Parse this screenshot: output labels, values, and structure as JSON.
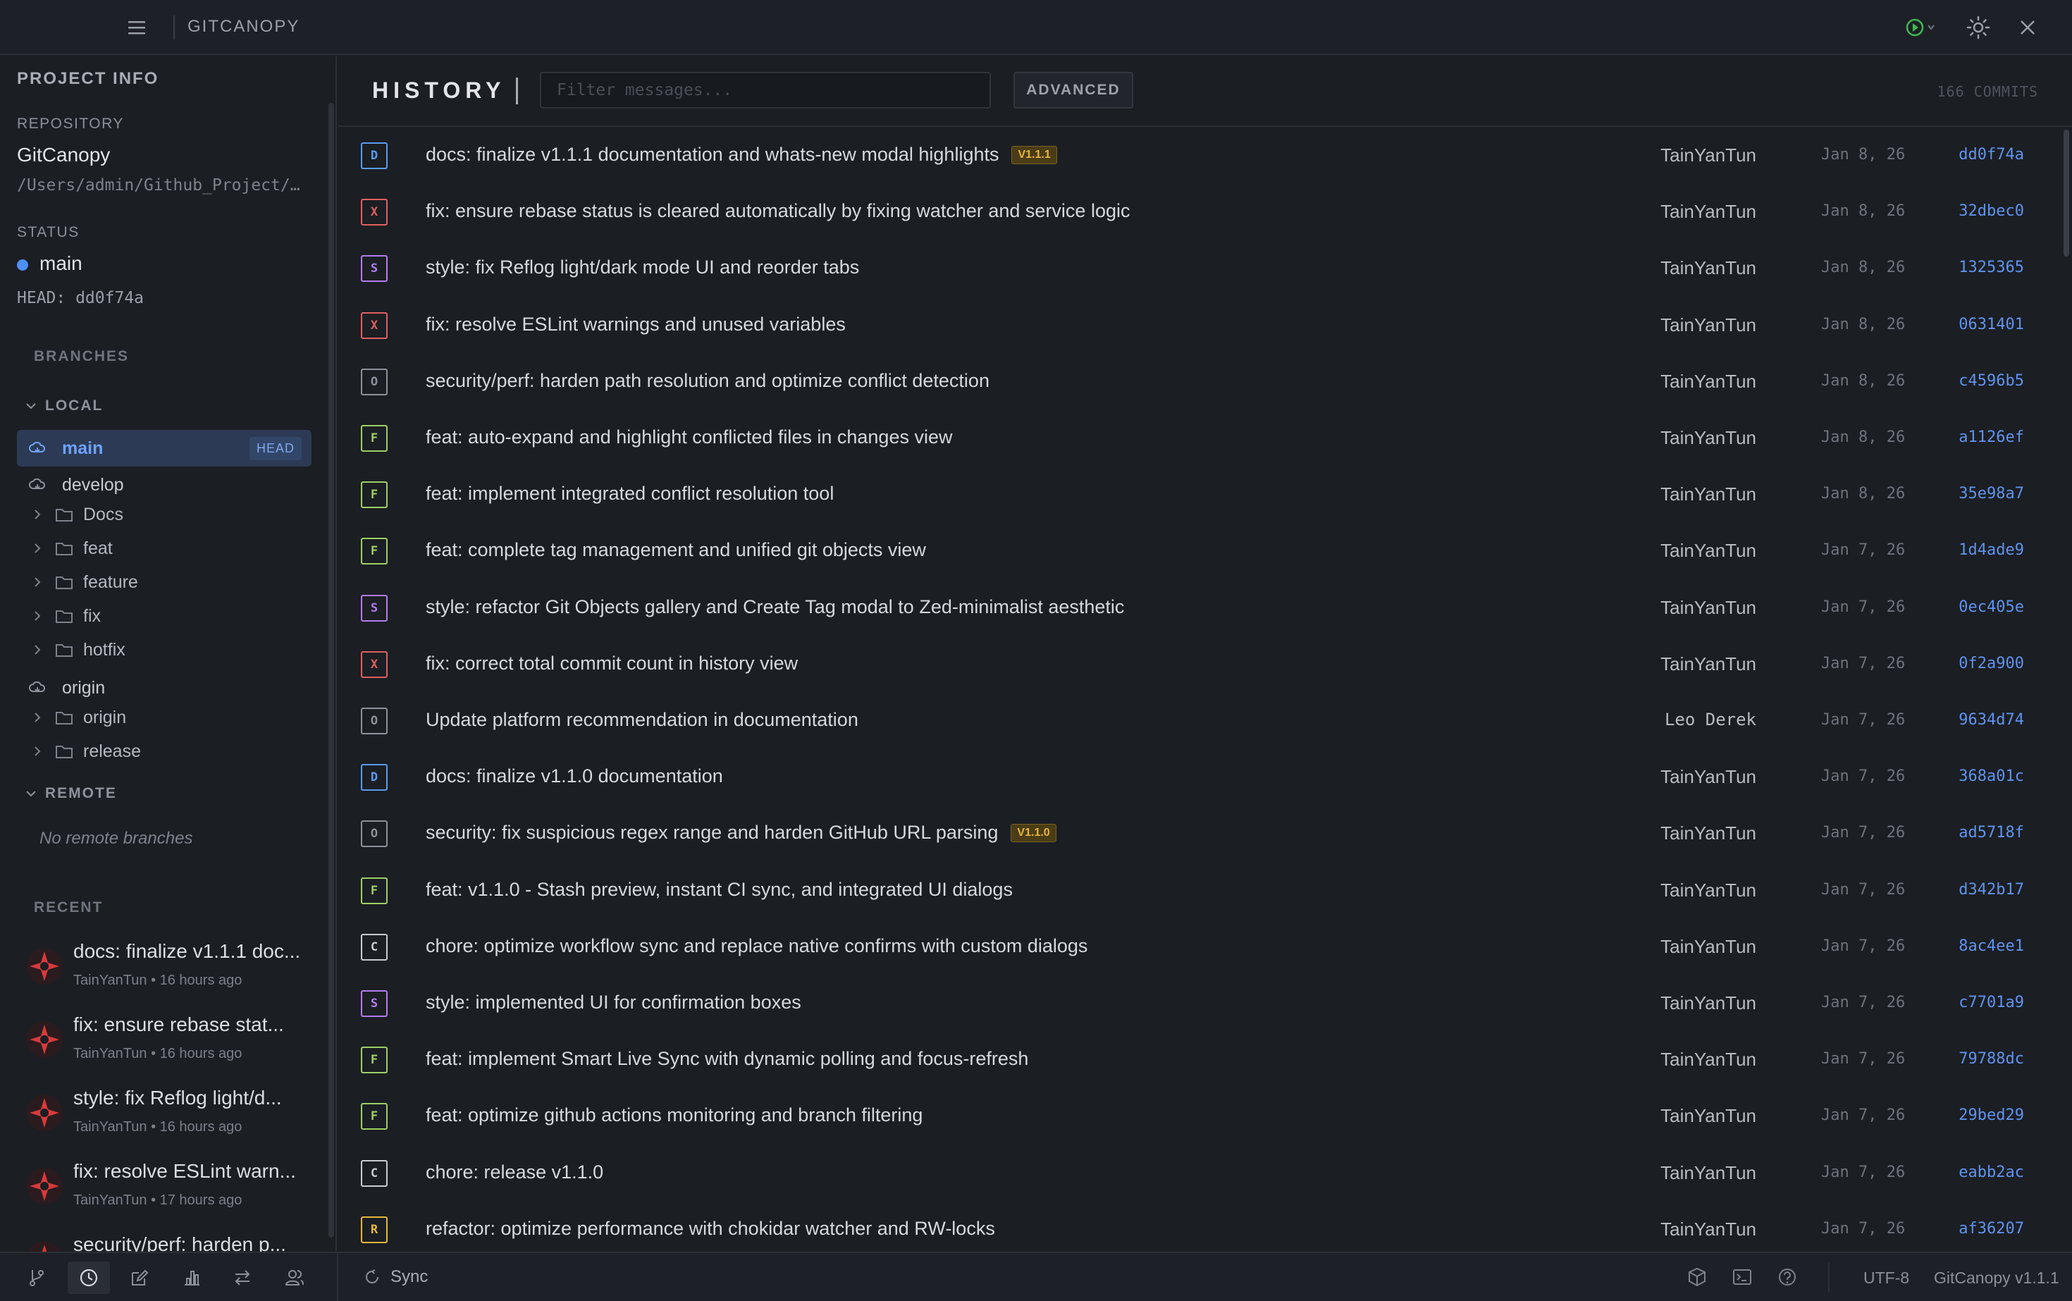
{
  "app": {
    "title": "GITCANOPY"
  },
  "sidebar": {
    "heading": "PROJECT INFO",
    "repository_label": "REPOSITORY",
    "repository_name": "GitCanopy",
    "repository_path": "/Users/admin/Github_Project/…",
    "status_label": "STATUS",
    "current_branch": "main",
    "head": "HEAD: dd0f74a",
    "branches_label": "BRANCHES",
    "local_label": "LOCAL",
    "local_items": [
      {
        "label": "main",
        "badge": "HEAD",
        "kind": "branch"
      },
      {
        "label": "develop",
        "kind": "branch"
      },
      {
        "label": "Docs",
        "kind": "folder"
      },
      {
        "label": "feat",
        "kind": "folder"
      },
      {
        "label": "feature",
        "kind": "folder"
      },
      {
        "label": "fix",
        "kind": "folder"
      },
      {
        "label": "hotfix",
        "kind": "folder"
      },
      {
        "label": "origin",
        "kind": "branch"
      },
      {
        "label": "origin",
        "kind": "folder"
      },
      {
        "label": "release",
        "kind": "folder"
      }
    ],
    "remote_label": "REMOTE",
    "no_remote": "No remote branches",
    "recent_label": "RECENT",
    "recent": [
      {
        "message": "docs: finalize v1.1.1 doc...",
        "meta": "TainYanTun • 16 hours ago"
      },
      {
        "message": "fix: ensure rebase stat...",
        "meta": "TainYanTun • 16 hours ago"
      },
      {
        "message": "style: fix Reflog light/d...",
        "meta": "TainYanTun • 16 hours ago"
      },
      {
        "message": "fix: resolve ESLint warn...",
        "meta": "TainYanTun • 17 hours ago"
      },
      {
        "message": "security/perf: harden p...",
        "meta": ""
      }
    ]
  },
  "history": {
    "title": "HISTORY",
    "filter_placeholder": "Filter messages...",
    "advanced_label": "ADVANCED",
    "count": "166 COMMITS",
    "commits": [
      {
        "type": "D",
        "message": "docs: finalize v1.1.1 documentation and whats-new modal highlights",
        "tag": "V1.1.1",
        "author": "TainYanTun",
        "date": "Jan 8, 26",
        "hash": "dd0f74a"
      },
      {
        "type": "X",
        "message": "fix: ensure rebase status is cleared automatically by fixing watcher and service logic",
        "tag": "",
        "author": "TainYanTun",
        "date": "Jan 8, 26",
        "hash": "32dbec0"
      },
      {
        "type": "S",
        "message": "style: fix Reflog light/dark mode UI and reorder tabs",
        "tag": "",
        "author": "TainYanTun",
        "date": "Jan 8, 26",
        "hash": "1325365"
      },
      {
        "type": "X",
        "message": "fix: resolve ESLint warnings and unused variables",
        "tag": "",
        "author": "TainYanTun",
        "date": "Jan 8, 26",
        "hash": "0631401"
      },
      {
        "type": "O",
        "message": "security/perf: harden path resolution and optimize conflict detection",
        "tag": "",
        "author": "TainYanTun",
        "date": "Jan 8, 26",
        "hash": "c4596b5"
      },
      {
        "type": "F",
        "message": "feat: auto-expand and highlight conflicted files in changes view",
        "tag": "",
        "author": "TainYanTun",
        "date": "Jan 8, 26",
        "hash": "a1126ef"
      },
      {
        "type": "F",
        "message": "feat: implement integrated conflict resolution tool",
        "tag": "",
        "author": "TainYanTun",
        "date": "Jan 8, 26",
        "hash": "35e98a7"
      },
      {
        "type": "F",
        "message": "feat: complete tag management and unified git objects view",
        "tag": "",
        "author": "TainYanTun",
        "date": "Jan 7, 26",
        "hash": "1d4ade9"
      },
      {
        "type": "S",
        "message": "style: refactor Git Objects gallery and Create Tag modal to Zed-minimalist aesthetic",
        "tag": "",
        "author": "TainYanTun",
        "date": "Jan 7, 26",
        "hash": "0ec405e"
      },
      {
        "type": "X",
        "message": "fix: correct total commit count in history view",
        "tag": "",
        "author": "TainYanTun",
        "date": "Jan 7, 26",
        "hash": "0f2a900"
      },
      {
        "type": "O",
        "message": "Update platform recommendation in documentation",
        "tag": "",
        "author": "Leo Derek",
        "date": "Jan 7, 26",
        "hash": "9634d74"
      },
      {
        "type": "D",
        "message": "docs: finalize v1.1.0 documentation",
        "tag": "",
        "author": "TainYanTun",
        "date": "Jan 7, 26",
        "hash": "368a01c"
      },
      {
        "type": "O",
        "message": "security: fix suspicious regex range and harden GitHub URL parsing",
        "tag": "V1.1.0",
        "author": "TainYanTun",
        "date": "Jan 7, 26",
        "hash": "ad5718f"
      },
      {
        "type": "F",
        "message": "feat: v1.1.0 - Stash preview, instant CI sync, and integrated UI dialogs",
        "tag": "",
        "author": "TainYanTun",
        "date": "Jan 7, 26",
        "hash": "d342b17"
      },
      {
        "type": "C",
        "message": "chore: optimize workflow sync and replace native confirms with custom dialogs",
        "tag": "",
        "author": "TainYanTun",
        "date": "Jan 7, 26",
        "hash": "8ac4ee1"
      },
      {
        "type": "S",
        "message": "style: implemented UI for confirmation boxes",
        "tag": "",
        "author": "TainYanTun",
        "date": "Jan 7, 26",
        "hash": "c7701a9"
      },
      {
        "type": "F",
        "message": "feat: implement Smart Live Sync with dynamic polling and focus-refresh",
        "tag": "",
        "author": "TainYanTun",
        "date": "Jan 7, 26",
        "hash": "79788dc"
      },
      {
        "type": "F",
        "message": "feat: optimize github actions monitoring and branch filtering",
        "tag": "",
        "author": "TainYanTun",
        "date": "Jan 7, 26",
        "hash": "29bed29"
      },
      {
        "type": "C",
        "message": "chore: release v1.1.0",
        "tag": "",
        "author": "TainYanTun",
        "date": "Jan 7, 26",
        "hash": "eabb2ac"
      },
      {
        "type": "R",
        "message": "refactor: optimize performance with chokidar watcher and RW-locks",
        "tag": "",
        "author": "TainYanTun",
        "date": "Jan 7, 26",
        "hash": "af36207"
      }
    ]
  },
  "type_colors": {
    "D": "#5b9bf0",
    "X": "#e0605f",
    "S": "#b37cf0",
    "O": "#8d939b",
    "F": "#9fcf63",
    "C": "#c9ccd2",
    "R": "#e8b63b"
  },
  "statusbar": {
    "sync_label": "Sync",
    "encoding": "UTF-8",
    "version": "GitCanopy v1.1.1"
  },
  "colors": {
    "accent": "#4f8ff7",
    "hash": "#5f93ee",
    "run_indicator": "#3fb950"
  }
}
